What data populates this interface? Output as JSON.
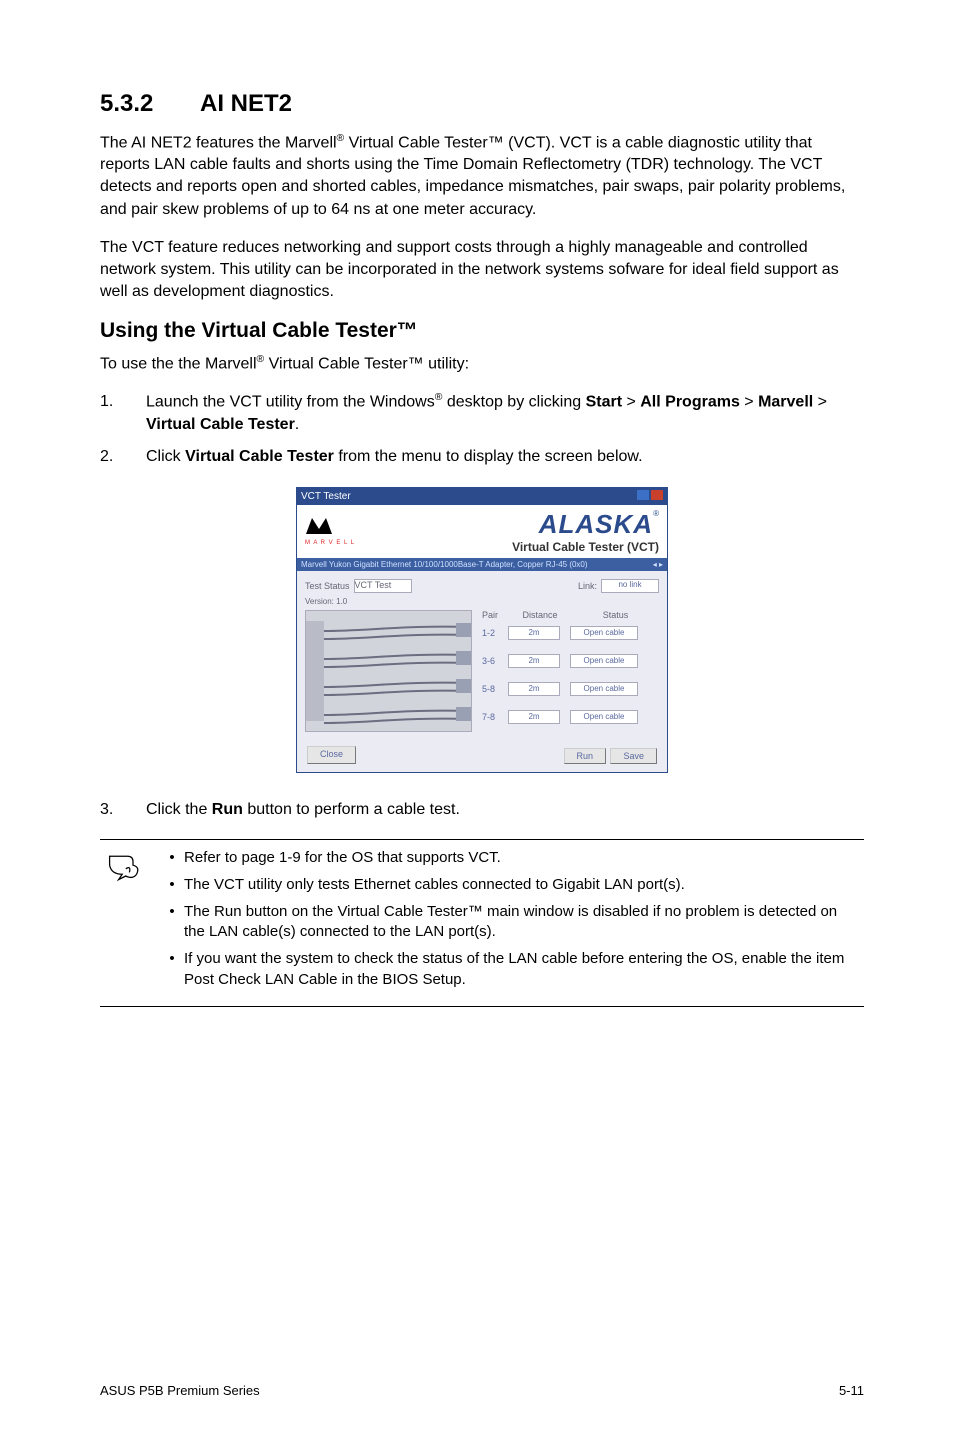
{
  "heading": {
    "number": "5.3.2",
    "title": "AI NET2"
  },
  "para1_parts": {
    "a": "The AI NET2 features the Marvell",
    "b": " Virtual Cable Tester™ (VCT). VCT is a cable diagnostic utility that reports LAN cable faults and shorts using the Time Domain Reflectometry (TDR) technology. The VCT detects and reports open and shorted cables, impedance mismatches, pair swaps, pair polarity problems, and pair skew problems of up to 64 ns at one meter accuracy."
  },
  "para2": "The VCT feature reduces networking and support costs through a highly manageable and controlled network system. This utility can be incorporated in the network systems sofware for ideal field support as well as development diagnostics.",
  "subheading": "Using the Virtual Cable Tester™",
  "intro_parts": {
    "a": "To use the the Marvell",
    "b": " Virtual Cable Tester™  utility:"
  },
  "steps": {
    "s1": {
      "num": "1.",
      "a": "Launch the VCT utility from the Windows",
      "b": " desktop by clicking ",
      "start": "Start",
      "gt1": " > ",
      "all": "All Programs",
      "gt2": " > ",
      "marvell": "Marvell",
      "gt3": " > ",
      "vct": "Virtual Cable Tester",
      "end": "."
    },
    "s2": {
      "num": "2.",
      "a": "Click ",
      "b": "Virtual Cable Tester",
      "c": " from the menu to display the screen below."
    },
    "s3": {
      "num": "3.",
      "a": "Click the ",
      "b": "Run",
      "c": " button to perform a cable test."
    }
  },
  "shot": {
    "title": "VCT Tester",
    "marvell_logo": "M",
    "marvell_sub": "M A R V E L L",
    "alaska": "ALASKA",
    "vct_label": "Virtual Cable Tester (VCT)",
    "tabs_left": "Marvell Yukon Gigabit Ethernet 10/100/1000Base-T Adapter, Copper RJ-45  (0x0)",
    "test_status": "Test Status",
    "vct_ver": "VCT Test",
    "version": "Version: 1.0",
    "link": "Link:",
    "link_val": "no link",
    "hdr_pair": "Pair",
    "hdr_dist": "Distance",
    "hdr_stat": "Status",
    "rows": [
      {
        "pair": "1-2",
        "dist": "2m",
        "stat": "Open cable"
      },
      {
        "pair": "3-6",
        "dist": "2m",
        "stat": "Open cable"
      },
      {
        "pair": "5-8",
        "dist": "2m",
        "stat": "Open cable"
      },
      {
        "pair": "7-8",
        "dist": "2m",
        "stat": "Open cable"
      }
    ],
    "btn_close": "Close",
    "btn_run": "Run",
    "btn_save": "Save"
  },
  "notes": {
    "n1": "Refer to page 1-9 for the OS that supports VCT.",
    "n2": "The VCT utility only tests Ethernet cables connected to Gigabit LAN port(s).",
    "n3": "The Run button on the Virtual Cable Tester™ main window is disabled if no problem is detected on the LAN cable(s) connected to the LAN port(s).",
    "n4": "If you want the system to check the status of the LAN cable before entering the OS, enable the item Post Check LAN Cable in the BIOS Setup."
  },
  "footer": {
    "left": "ASUS P5B Premium Series",
    "right": "5-11"
  },
  "reg_mark": "®"
}
